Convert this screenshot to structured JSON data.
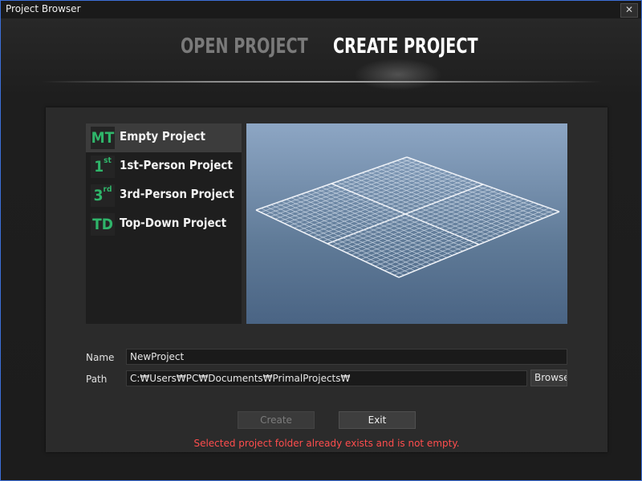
{
  "window": {
    "title": "Project Browser",
    "close_glyph": "✕"
  },
  "tabs": [
    {
      "label": "OPEN PROJECT",
      "active": false
    },
    {
      "label": "CREATE PROJECT",
      "active": true
    }
  ],
  "templates": [
    {
      "icon_text": "MT",
      "icon_sup": "",
      "label": "Empty Project",
      "selected": true
    },
    {
      "icon_text": "1",
      "icon_sup": "st",
      "label": "1st-Person Project",
      "selected": false
    },
    {
      "icon_text": "3",
      "icon_sup": "rd",
      "label": "3rd-Person Project",
      "selected": false
    },
    {
      "icon_text": "TD",
      "icon_sup": "",
      "label": "Top-Down Project",
      "selected": false
    }
  ],
  "form": {
    "name_label": "Name",
    "name_value": "NewProject",
    "path_label": "Path",
    "path_value": "C:₩Users₩PC₩Documents₩PrimalProjects₩",
    "browse_label": "Browse"
  },
  "actions": {
    "create_label": "Create",
    "create_enabled": false,
    "exit_label": "Exit"
  },
  "status": {
    "error_message": "Selected project folder already exists and is not empty."
  },
  "colors": {
    "accent_green": "#2fb56a",
    "error_red": "#ff4d4d",
    "window_border": "#3c6fd8"
  }
}
